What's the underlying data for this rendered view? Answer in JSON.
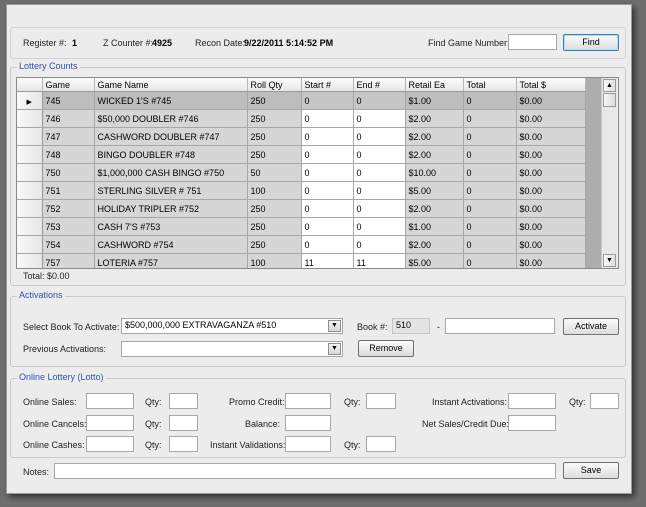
{
  "header": {
    "register_label": "Register #:",
    "register_value": "1",
    "zcounter_label": "Z Counter #:",
    "zcounter_value": "4925",
    "recon_label": "Recon Date:",
    "recon_value": "9/22/2011 5:14:52 PM",
    "find_label": "Find Game Number:",
    "find_value": "",
    "find_button": "Find"
  },
  "lottery_counts": {
    "title": "Lottery Counts",
    "columns": [
      "Game",
      "Game Name",
      "Roll Qty",
      "Start #",
      "End #",
      "Retail Ea",
      "Total",
      "Total $"
    ],
    "rows": [
      [
        "745",
        "WICKED 1'S #745",
        "250",
        "0",
        "0",
        "$1.00",
        "0",
        "$0.00"
      ],
      [
        "746",
        "$50,000 DOUBLER #746",
        "250",
        "0",
        "0",
        "$2.00",
        "0",
        "$0.00"
      ],
      [
        "747",
        "CASHWORD DOUBLER #747",
        "250",
        "0",
        "0",
        "$2.00",
        "0",
        "$0.00"
      ],
      [
        "748",
        "BINGO DOUBLER #748",
        "250",
        "0",
        "0",
        "$2.00",
        "0",
        "$0.00"
      ],
      [
        "750",
        "$1,000,000 CASH BINGO #750",
        "50",
        "0",
        "0",
        "$10.00",
        "0",
        "$0.00"
      ],
      [
        "751",
        "STERLING SILVER # 751",
        "100",
        "0",
        "0",
        "$5.00",
        "0",
        "$0.00"
      ],
      [
        "752",
        "HOLIDAY TRIPLER #752",
        "250",
        "0",
        "0",
        "$2.00",
        "0",
        "$0.00"
      ],
      [
        "753",
        "CASH 7'S #753",
        "250",
        "0",
        "0",
        "$1.00",
        "0",
        "$0.00"
      ],
      [
        "754",
        "CASHWORD #754",
        "250",
        "0",
        "0",
        "$2.00",
        "0",
        "$0.00"
      ],
      [
        "757",
        "LOTERIA #757",
        "100",
        "11",
        "11",
        "$5.00",
        "0",
        "$0.00"
      ]
    ],
    "selected_row": 0,
    "total_label": "Total: $0.00"
  },
  "activations": {
    "title": "Activations",
    "select_label": "Select Book To Activate:",
    "select_value": "$500,000,000 EXTRAVAGANZA #510",
    "book_label": "Book #:",
    "book_value": "510",
    "dash": "-",
    "book_suffix": "",
    "activate_button": "Activate",
    "previous_label": "Previous Activations:",
    "previous_value": "",
    "remove_button": "Remove"
  },
  "online": {
    "title": "Online Lottery (Lotto)",
    "sales_label": "Online Sales:",
    "cancels_label": "Online Cancels:",
    "cashes_label": "Online Cashes:",
    "qty_label": "Qty:",
    "promo_label": "Promo Credit:",
    "balance_label": "Balance:",
    "instant_validations_label": "Instant Validations:",
    "instant_activations_label": "Instant Activations:",
    "net_sales_label": "Net Sales/Credit Due:"
  },
  "notes": {
    "label": "Notes:",
    "value": "",
    "save_button": "Save"
  }
}
